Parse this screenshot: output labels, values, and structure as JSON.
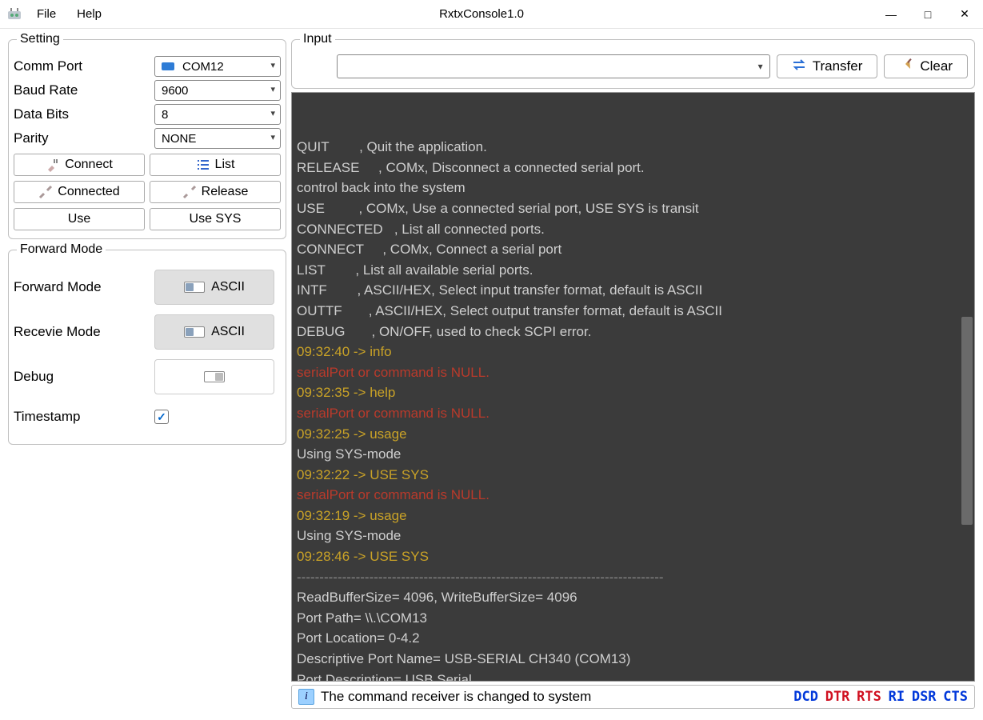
{
  "window": {
    "title": "RxtxConsole1.0",
    "menus": {
      "file": "File",
      "help": "Help"
    }
  },
  "setting": {
    "legend": "Setting",
    "comm_port": {
      "label": "Comm Port",
      "value": "COM12"
    },
    "baud_rate": {
      "label": "Baud Rate",
      "value": "9600"
    },
    "data_bits": {
      "label": "Data Bits",
      "value": "8"
    },
    "parity": {
      "label": "Parity",
      "value": "NONE"
    },
    "buttons": {
      "connect": "Connect",
      "list": "List",
      "connected": "Connected",
      "release": "Release",
      "use": "Use",
      "use_sys": "Use SYS"
    }
  },
  "forward": {
    "legend": "Forward Mode",
    "forward_mode": {
      "label": "Forward Mode",
      "value": "ASCII"
    },
    "receive_mode": {
      "label": "Recevie Mode",
      "value": "ASCII"
    },
    "debug": {
      "label": "Debug"
    },
    "timestamp": {
      "label": "Timestamp",
      "checked": true
    }
  },
  "input": {
    "legend": "Input",
    "transfer": "Transfer",
    "clear": "Clear"
  },
  "console_lines": [
    {
      "cls": "",
      "text": "Port Description= USB Serial"
    },
    {
      "cls": "",
      "text": "Descriptive Port Name= USB-SERIAL CH340 (COM13)"
    },
    {
      "cls": "",
      "text": "Port Location= 0-4.2"
    },
    {
      "cls": "",
      "text": "Port Path= \\\\.\\COM13"
    },
    {
      "cls": "",
      "text": "ReadBufferSize= 4096, WriteBufferSize= 4096"
    },
    {
      "cls": "divider",
      "text": "---------------------------------------------------------------------------------"
    },
    {
      "cls": "ts",
      "text": "09:28:46 -> USE SYS"
    },
    {
      "cls": "",
      "text": "Using SYS-mode"
    },
    {
      "cls": "ts",
      "text": "09:32:19 -> usage"
    },
    {
      "cls": "err",
      "text": "serialPort or command is NULL."
    },
    {
      "cls": "ts",
      "text": "09:32:22 -> USE SYS"
    },
    {
      "cls": "",
      "text": "Using SYS-mode"
    },
    {
      "cls": "ts",
      "text": "09:32:25 -> usage"
    },
    {
      "cls": "err",
      "text": "serialPort or command is NULL."
    },
    {
      "cls": "ts",
      "text": "09:32:35 -> help"
    },
    {
      "cls": "err",
      "text": "serialPort or command is NULL."
    },
    {
      "cls": "ts",
      "text": "09:32:40 -> info"
    },
    {
      "cls": "",
      "text": "DEBUG       , ON/OFF, used to check SCPI error."
    },
    {
      "cls": "",
      "text": "OUTTF       , ASCII/HEX, Select output transfer format, default is ASCII"
    },
    {
      "cls": "",
      "text": "INTF        , ASCII/HEX, Select input transfer format, default is ASCII"
    },
    {
      "cls": "",
      "text": "LIST        , List all available serial ports."
    },
    {
      "cls": "",
      "text": "CONNECT     , COMx, Connect a serial port"
    },
    {
      "cls": "",
      "text": "CONNECTED   , List all connected ports."
    },
    {
      "cls": "",
      "text": "USE         , COMx, Use a connected serial port, USE SYS is transit"
    },
    {
      "cls": "",
      "text": "control back into the system"
    },
    {
      "cls": "",
      "text": "RELEASE     , COMx, Disconnect a connected serial port."
    },
    {
      "cls": "",
      "text": "QUIT        , Quit the application."
    }
  ],
  "status": {
    "message": "The command receiver is changed to system",
    "signals": [
      {
        "name": "DCD",
        "cls": "blue"
      },
      {
        "name": "DTR",
        "cls": "red"
      },
      {
        "name": "RTS",
        "cls": "red"
      },
      {
        "name": "RI",
        "cls": "blue"
      },
      {
        "name": "DSR",
        "cls": "blue"
      },
      {
        "name": "CTS",
        "cls": "blue"
      }
    ]
  }
}
